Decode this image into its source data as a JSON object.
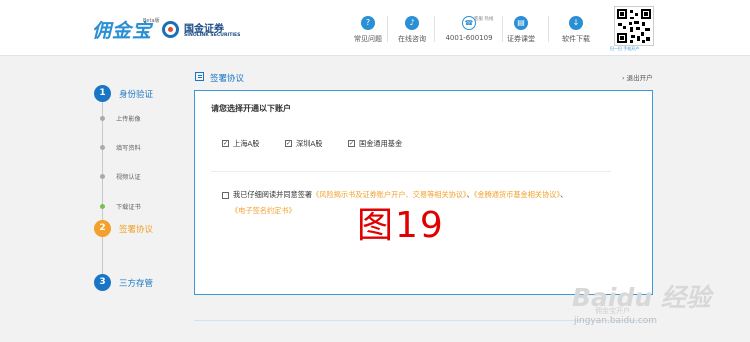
{
  "header": {
    "logo_text": "佣金宝",
    "beta_label": "Beta版",
    "brand_cn": "国金证券",
    "brand_en": "SINOLINK SECURITIES",
    "nav": [
      {
        "icon": "chat-bubble-icon",
        "glyph": "?",
        "label": "常见问题"
      },
      {
        "icon": "bell-icon",
        "glyph": "♪",
        "label": "在线咨询"
      },
      {
        "icon": "phone-icon",
        "glyph": "☎",
        "label": "4001-600109",
        "sub": "客服 热线"
      },
      {
        "icon": "classroom-icon",
        "glyph": "▤",
        "label": "证券课堂"
      },
      {
        "icon": "download-icon",
        "glyph": "↓",
        "label": "软件下载"
      }
    ],
    "qr_caption": "扫一扫 手机开户"
  },
  "steps": [
    {
      "num": "1",
      "label": "身份验证",
      "state": "done"
    },
    {
      "num": "2",
      "label": "签署协议",
      "state": "active"
    },
    {
      "num": "3",
      "label": "三方存管",
      "state": "done"
    }
  ],
  "substeps": [
    {
      "label": "上传影像"
    },
    {
      "label": "填写资料"
    },
    {
      "label": "视频认证"
    },
    {
      "label": "下载证书"
    }
  ],
  "section": {
    "title": "签署协议",
    "exit_link": "› 退出开户"
  },
  "form": {
    "heading": "请您选择开通以下账户",
    "accounts": [
      {
        "label": "上海A股",
        "checked": true
      },
      {
        "label": "深圳A股",
        "checked": true
      },
      {
        "label": "国金通用基金",
        "checked": true
      }
    ],
    "agree_prefix": "我已仔细阅读并同意签署",
    "agree_link1": "《风险揭示书及证券账户开户、交易等相关协议》",
    "agree_sep1": "、",
    "agree_link2": "《金腾通货币基金相关协议》",
    "agree_sep2": "、",
    "agree_link3": "《电子签名约定书》"
  },
  "watermark": "图19",
  "baidu_mark": {
    "main": "Baidu 经验",
    "sub": "佣金宝开户",
    "url": "jingyan.baidu.com"
  }
}
